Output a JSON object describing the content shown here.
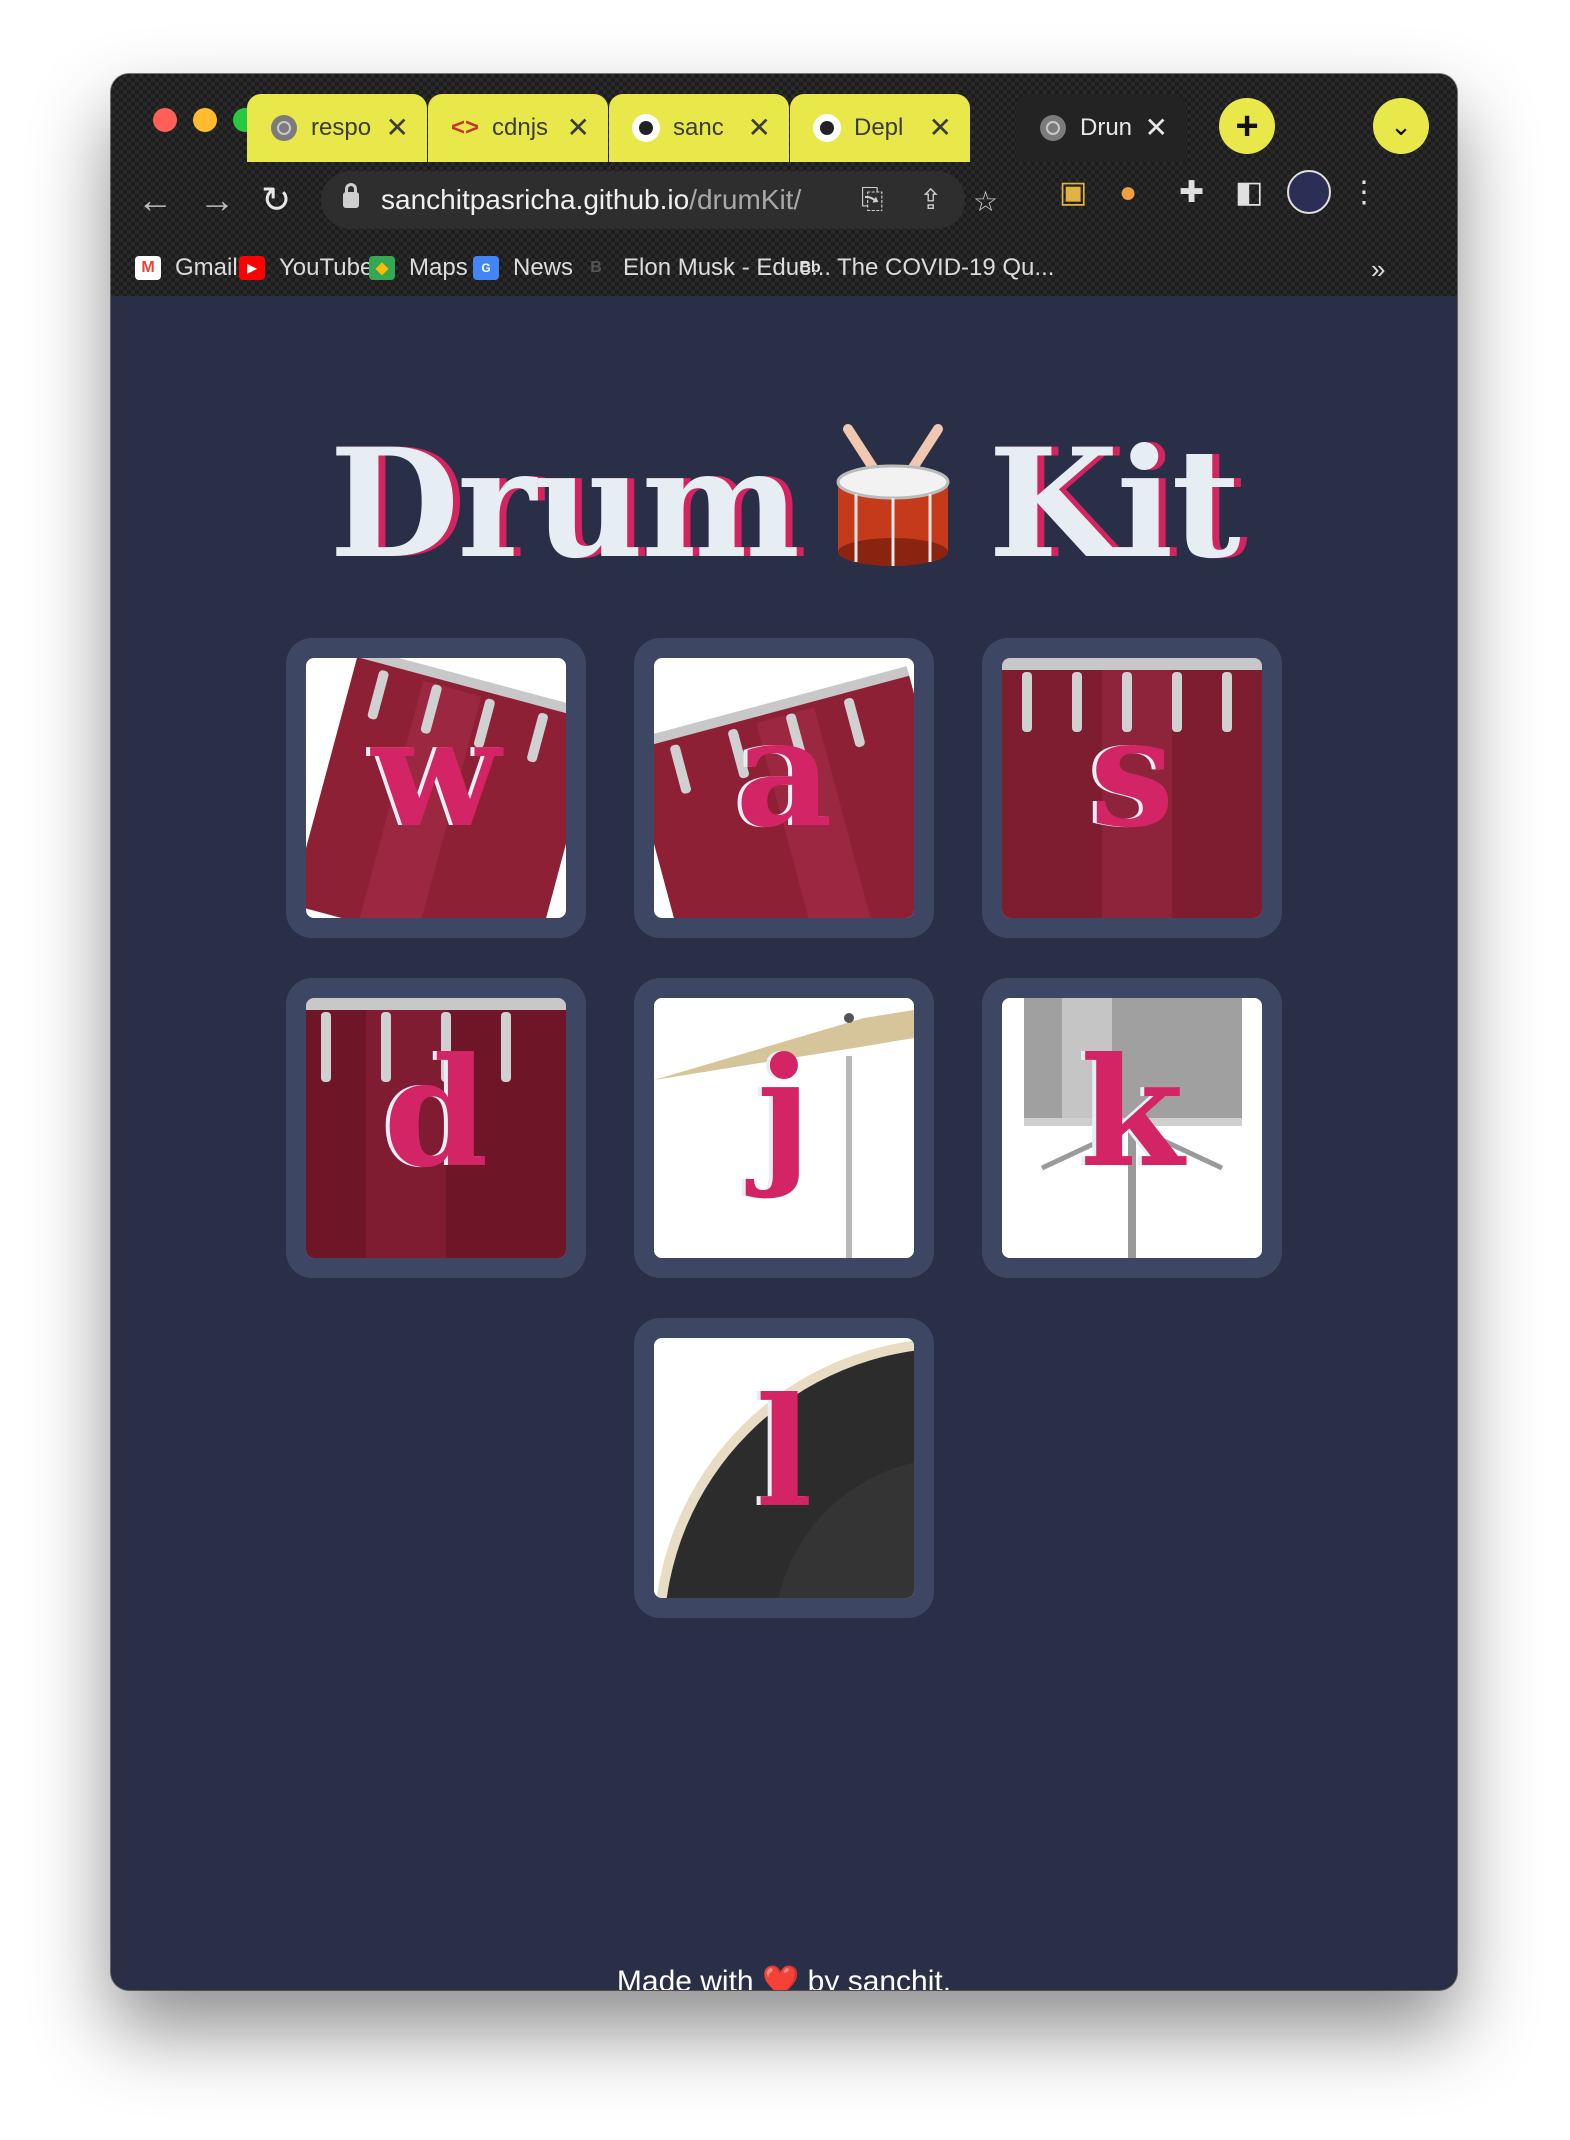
{
  "browser": {
    "tabs": [
      {
        "title": "respo",
        "icon": "globe-icon",
        "style": "yellow"
      },
      {
        "title": "cdnjs",
        "icon": "code-brackets-icon",
        "style": "yellow"
      },
      {
        "title": "sanc",
        "icon": "github-icon",
        "style": "yellow"
      },
      {
        "title": "Depl",
        "icon": "github-icon",
        "style": "yellow"
      },
      {
        "title": "Drun",
        "icon": "globe-icon",
        "style": "active"
      }
    ],
    "close_glyph": "✕",
    "new_tab_glyph": "+",
    "url_host": "sanchitpasricha.github.io",
    "url_path": "/drumKit/",
    "bookmarks": [
      {
        "label": "Gmail",
        "icon": "gmail-icon"
      },
      {
        "label": "YouTube",
        "icon": "youtube-icon"
      },
      {
        "label": "Maps",
        "icon": "maps-icon"
      },
      {
        "label": "News",
        "icon": "news-icon"
      },
      {
        "label": "Elon Musk - Educ...",
        "icon": "b-icon"
      },
      {
        "label": "The COVID-19 Qu...",
        "icon": "bb-icon"
      }
    ],
    "bookmarks_overflow": "»"
  },
  "page": {
    "title_left": "Drum",
    "title_emoji": "🥁",
    "title_right": "Kit",
    "pads": [
      {
        "key": "w",
        "sound": "tom-1"
      },
      {
        "key": "a",
        "sound": "tom-2"
      },
      {
        "key": "s",
        "sound": "tom-3"
      },
      {
        "key": "d",
        "sound": "tom-4"
      },
      {
        "key": "j",
        "sound": "crash"
      },
      {
        "key": "k",
        "sound": "snare"
      },
      {
        "key": "l",
        "sound": "kick-bass"
      }
    ],
    "footer_prefix": "Made with",
    "footer_heart": "❤️",
    "footer_suffix": "by sanchit."
  },
  "colors": {
    "page_bg": "#292f46",
    "pad_bg": "#3d4663",
    "accent": "#d32565",
    "tab_yellow": "#e8e84a"
  }
}
